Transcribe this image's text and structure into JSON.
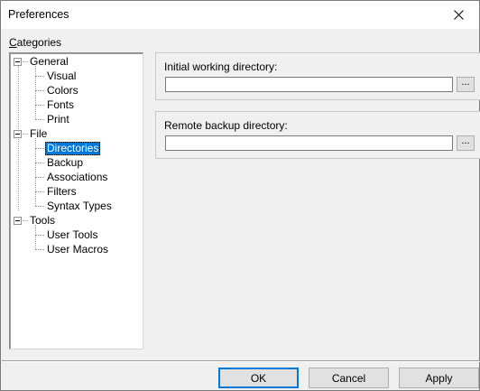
{
  "window": {
    "title": "Preferences"
  },
  "categories": {
    "label_prefix": "C",
    "label_rest": "ategories",
    "tree": [
      {
        "label": "General",
        "children": [
          "Visual",
          "Colors",
          "Fonts",
          "Print"
        ]
      },
      {
        "label": "File",
        "children": [
          "Directories",
          "Backup",
          "Associations",
          "Filters",
          "Syntax Types"
        ]
      },
      {
        "label": "Tools",
        "children": [
          "User Tools",
          "User Macros"
        ]
      }
    ],
    "selected": "Directories"
  },
  "settings": {
    "initial_dir": {
      "label": "Initial working directory:",
      "value": "",
      "browse": "..."
    },
    "backup_dir": {
      "label": "Remote backup directory:",
      "value": "",
      "browse": "..."
    }
  },
  "buttons": {
    "ok": "OK",
    "cancel": "Cancel",
    "apply": "Apply"
  },
  "colors": {
    "selection": "#0078d7",
    "face": "#f0f0f0"
  }
}
